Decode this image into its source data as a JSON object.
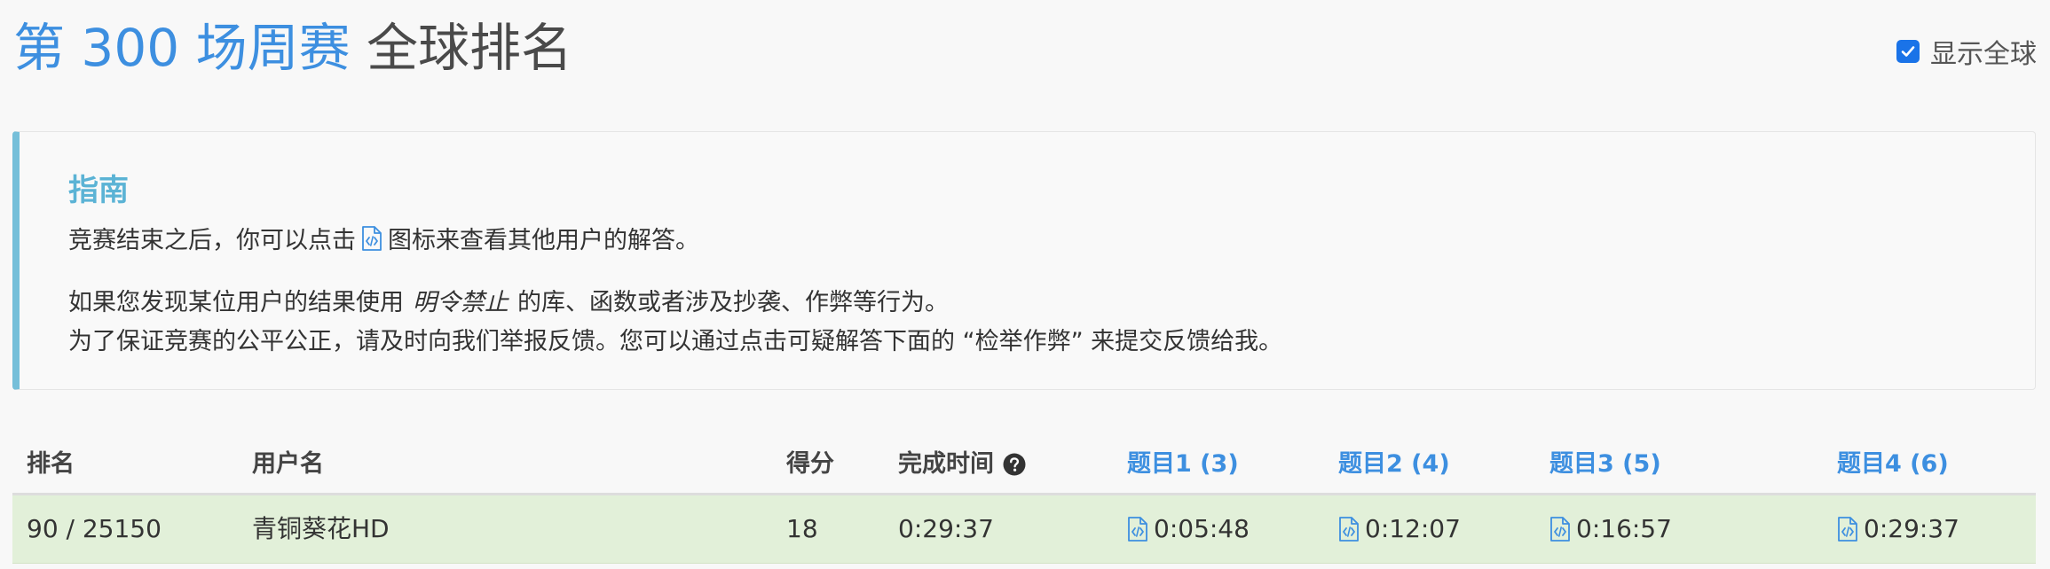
{
  "header": {
    "contest_title": "第 300 场周赛",
    "title_suffix": "全球排名",
    "show_global_label": "显示全球",
    "show_global_checked": true
  },
  "guide": {
    "title": "指南",
    "line1_before": "竞赛结束之后，你可以点击",
    "line1_after": "图标来查看其他用户的解答。",
    "line2_before": "如果您发现某位用户的结果使用",
    "line2_emphasis": "明令禁止",
    "line2_after": "的库、函数或者涉及抄袭、作弊等行为。",
    "line3": "为了保证竞赛的公平公正，请及时向我们举报反馈。您可以通过点击可疑解答下面的 “检举作弊” 来提交反馈给我。"
  },
  "table": {
    "columns": {
      "rank": "排名",
      "username": "用户名",
      "score": "得分",
      "finish_time": "完成时间",
      "q1": "题目1 (3)",
      "q2": "题目2 (4)",
      "q3": "题目3 (5)",
      "q4": "题目4 (6)"
    },
    "rows": [
      {
        "rank": "90 / 25150",
        "username": "青铜葵花HD",
        "score": "18",
        "finish_time": "0:29:37",
        "q1": "0:05:48",
        "q2": "0:12:07",
        "q3": "0:16:57",
        "q4": "0:29:37"
      }
    ]
  },
  "colors": {
    "accent_blue": "#3d8fe0",
    "guide_accent": "#5bb3d5",
    "row_highlight": "#e2f0d9",
    "checkbox_blue": "#1a73e8"
  },
  "icons": {
    "code": "code-file-icon",
    "help": "question-circle-icon",
    "check": "checkmark-icon"
  }
}
